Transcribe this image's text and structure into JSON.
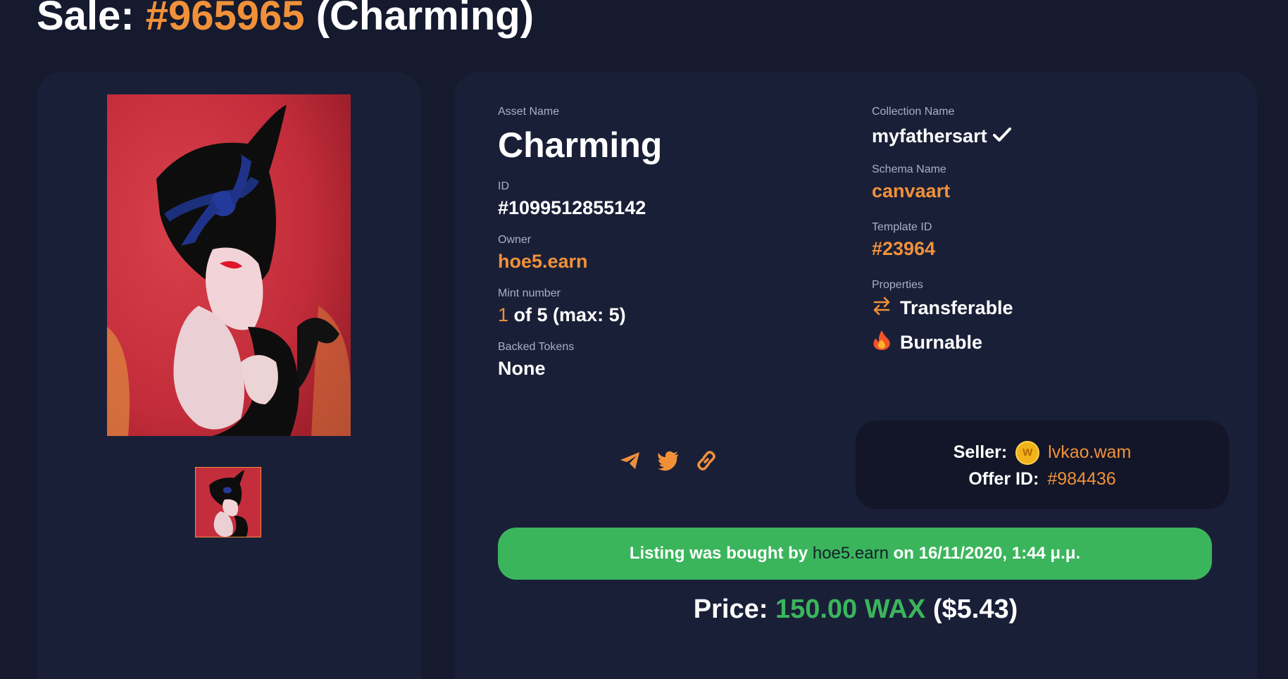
{
  "header": {
    "prefix": "Sale:",
    "sale_id": "#965965",
    "asset_paren": "(Charming)"
  },
  "details": {
    "asset_name_label": "Asset Name",
    "asset_name": "Charming",
    "id_label": "ID",
    "id": "#1099512855142",
    "owner_label": "Owner",
    "owner": "hoe5.earn",
    "mint_label": "Mint number",
    "mint_number": "1",
    "mint_rest": "of 5 (max: 5)",
    "backed_label": "Backed Tokens",
    "backed": "None",
    "collection_label": "Collection Name",
    "collection": "myfathersart",
    "schema_label": "Schema Name",
    "schema": "canvaart",
    "template_label": "Template ID",
    "template": "#23964",
    "properties_label": "Properties",
    "properties": [
      "Transferable",
      "Burnable"
    ]
  },
  "share_icons": [
    "telegram-icon",
    "twitter-icon",
    "link-icon"
  ],
  "seller": {
    "label": "Seller:",
    "coin_letter": "W",
    "name": "lvkao.wam",
    "offer_label": "Offer ID:",
    "offer_id": "#984436"
  },
  "bought": {
    "prefix": "Listing was bought by",
    "buyer": "hoe5.earn",
    "suffix": "on 16/11/2020, 1:44 μ.μ."
  },
  "price": {
    "label": "Price:",
    "amount": "150.00 WAX",
    "usd": "($5.43)"
  },
  "colors": {
    "background": "#151a2e",
    "card": "#1a1f38",
    "accent": "#f0913a",
    "green": "#3bb55c"
  }
}
